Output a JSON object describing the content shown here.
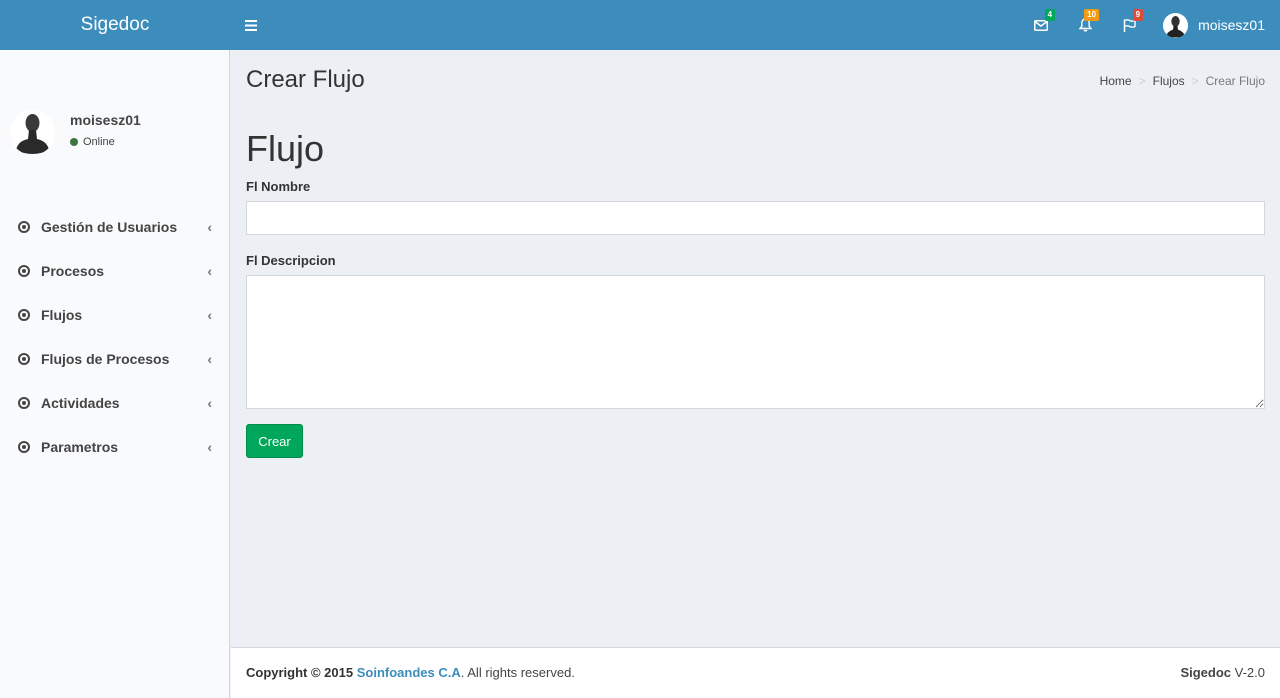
{
  "header": {
    "logo": "Sigedoc",
    "user_name": "moisesz01",
    "messages_count": "4",
    "notifications_count": "10",
    "tasks_count": "9"
  },
  "sidebar": {
    "user_name": "moisesz01",
    "user_status": "Online",
    "items": [
      {
        "label": "Gestión de Usuarios"
      },
      {
        "label": "Procesos"
      },
      {
        "label": "Flujos"
      },
      {
        "label": "Flujos de Procesos"
      },
      {
        "label": "Actividades"
      },
      {
        "label": "Parametros"
      }
    ]
  },
  "main": {
    "page_title": "Crear Flujo",
    "breadcrumb": [
      "Home",
      "Flujos",
      "Crear Flujo"
    ],
    "form_title": "Flujo",
    "fields": {
      "nombre_label": "Fl Nombre",
      "nombre_value": "",
      "descripcion_label": "Fl Descripcion",
      "descripcion_value": ""
    },
    "submit_label": "Crear"
  },
  "footer": {
    "copyright": "Copyright © 2015",
    "company": "Soinfoandes C.A",
    "rights": ". All rights reserved.",
    "app_name": "Sigedoc",
    "version": "V-2.0"
  }
}
